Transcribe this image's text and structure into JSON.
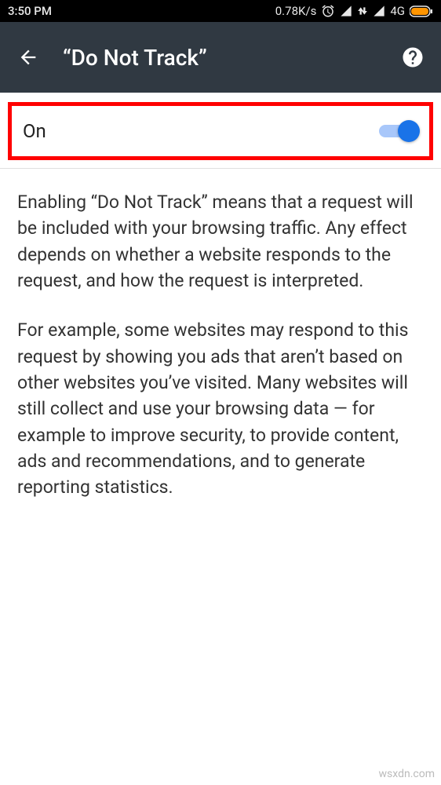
{
  "statusBar": {
    "time": "3:50 PM",
    "speed": "0.78K/s",
    "network": "4G"
  },
  "appBar": {
    "title": "“Do Not Track”"
  },
  "toggle": {
    "label": "On"
  },
  "description": {
    "p1": "Enabling “Do Not Track” means that a request will be included with your browsing traffic. Any effect depends on whether a website responds to the request, and how the request is interpreted.",
    "p2": "For example, some websites may respond to this request by showing you ads that aren’t based on other websites you’ve visited. Many websites will still collect and use your brows­ing data — for example to improve security, to provide content, ads and recommendations, and to generate reporting statistics."
  },
  "watermark": "wsxdn.com"
}
